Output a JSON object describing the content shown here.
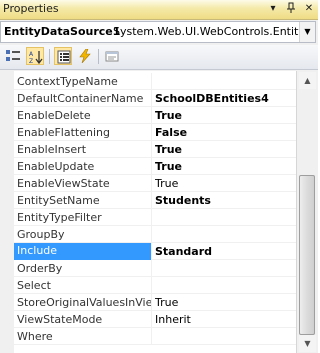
{
  "window": {
    "title": "Properties"
  },
  "selector": {
    "object_name": "EntityDataSource1",
    "object_type": "System.Web.UI.WebControls.EntityD"
  },
  "toolbar": {
    "tools": [
      {
        "name": "categorized-button",
        "icon": "categorized-icon"
      },
      {
        "name": "alphabetical-button",
        "icon": "alphabetical-icon",
        "pressed": true
      },
      {
        "name": "properties-button",
        "icon": "properties-icon",
        "pressed": true
      },
      {
        "name": "events-button",
        "icon": "lightning-icon"
      },
      {
        "name": "property-pages-button",
        "icon": "property-pages-icon"
      }
    ]
  },
  "properties": [
    {
      "name": "ContextTypeName",
      "value": "",
      "bold": false
    },
    {
      "name": "DefaultContainerName",
      "value": "SchoolDBEntities4",
      "bold": true
    },
    {
      "name": "EnableDelete",
      "value": "True",
      "bold": true
    },
    {
      "name": "EnableFlattening",
      "value": "False",
      "bold": true
    },
    {
      "name": "EnableInsert",
      "value": "True",
      "bold": true
    },
    {
      "name": "EnableUpdate",
      "value": "True",
      "bold": true
    },
    {
      "name": "EnableViewState",
      "value": "True",
      "bold": false
    },
    {
      "name": "EntitySetName",
      "value": "Students",
      "bold": true
    },
    {
      "name": "EntityTypeFilter",
      "value": "",
      "bold": false
    },
    {
      "name": "GroupBy",
      "value": "",
      "bold": false
    },
    {
      "name": "Include",
      "value": "Standard",
      "bold": true,
      "selected": true
    },
    {
      "name": "OrderBy",
      "value": "",
      "bold": false
    },
    {
      "name": "Select",
      "value": "",
      "bold": false
    },
    {
      "name": "StoreOriginalValuesInViewState",
      "value": "True",
      "bold": false
    },
    {
      "name": "ViewStateMode",
      "value": "Inherit",
      "bold": false
    },
    {
      "name": "Where",
      "value": "",
      "bold": false
    }
  ],
  "colors": {
    "selection": "#3399ff",
    "titlebar": "#f4e9a7"
  }
}
